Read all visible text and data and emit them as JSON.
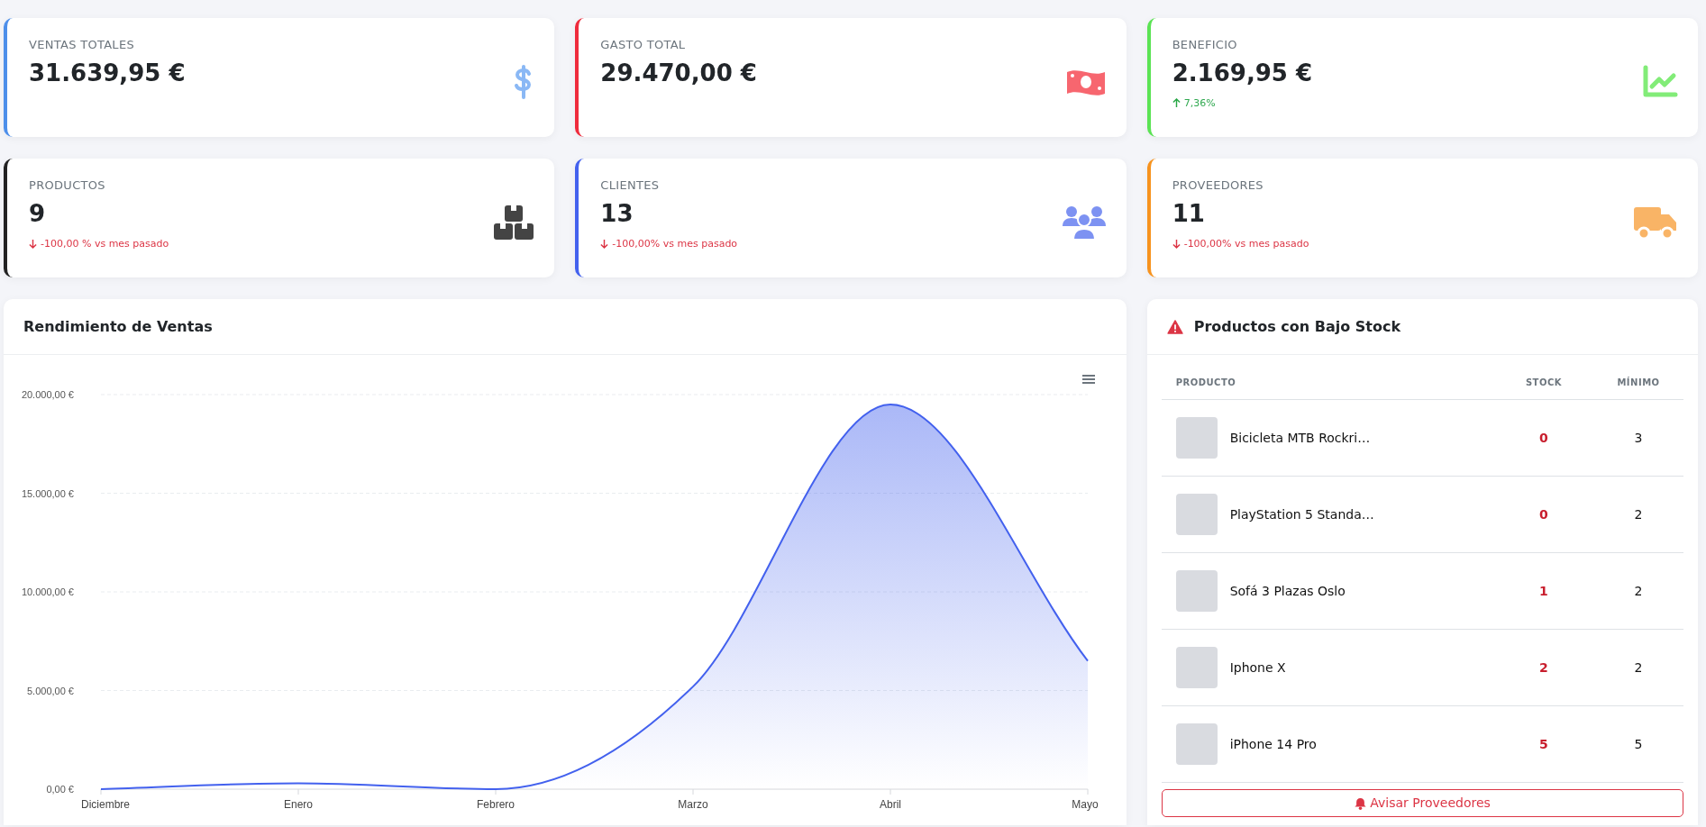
{
  "stat_cards": [
    {
      "label": "VENTAS TOTALES",
      "value": "31.639,95 €",
      "color": "#4d8fea"
    },
    {
      "label": "GASTO TOTAL",
      "value": "29.470,00 €",
      "color": "#ef2b3c"
    },
    {
      "label": "BENEFICIO",
      "value": "2.169,95 €",
      "color": "#5be354",
      "trend": {
        "kind": "up",
        "text": "7,36%"
      }
    },
    {
      "label": "PRODUCTOS",
      "value": "9",
      "color": "#222222",
      "trend": {
        "kind": "down",
        "text": "-100,00 % vs mes pasado"
      }
    },
    {
      "label": "CLIENTES",
      "value": "13",
      "color": "#4361ee",
      "trend": {
        "kind": "down",
        "text": "-100,00% vs mes pasado"
      }
    },
    {
      "label": "PROVEEDORES",
      "value": "11",
      "color": "#f7931e",
      "trend": {
        "kind": "down",
        "text": "-100,00% vs mes pasado"
      }
    }
  ],
  "sales_chart": {
    "title": "Rendimiento de Ventas",
    "chart_data": {
      "type": "area",
      "categories": [
        "Diciembre",
        "Enero",
        "Febrero",
        "Marzo",
        "Abril",
        "Mayo"
      ],
      "series": [
        {
          "color": "#4361ee",
          "values": [
            0,
            300,
            0,
            5200,
            19500,
            6500
          ]
        }
      ],
      "grid": true,
      "ylim": [
        0,
        20000
      ],
      "yticks": [
        {
          "value": 0,
          "label": "0,00 €"
        },
        {
          "value": 5000,
          "label": "5.000,00 €"
        },
        {
          "value": 10000,
          "label": "10.000,00 €"
        },
        {
          "value": 15000,
          "label": "15.000,00 €"
        },
        {
          "value": 20000,
          "label": "20.000,00 €"
        }
      ]
    }
  },
  "low_stock": {
    "title": "Productos con Bajo Stock",
    "columns": [
      "PRODUCTO",
      "STOCK",
      "MÍNIMO"
    ],
    "rows": [
      {
        "product": "Bicicleta MTB Rockri…",
        "stock": "0",
        "minimum": "3"
      },
      {
        "product": "PlayStation 5 Standa…",
        "stock": "0",
        "minimum": "2"
      },
      {
        "product": "Sofá 3 Plazas Oslo",
        "stock": "1",
        "minimum": "2"
      },
      {
        "product": "Iphone X",
        "stock": "2",
        "minimum": "2"
      },
      {
        "product": "iPhone 14 Pro",
        "stock": "5",
        "minimum": "5"
      }
    ],
    "button": "Avisar Proveedores"
  }
}
